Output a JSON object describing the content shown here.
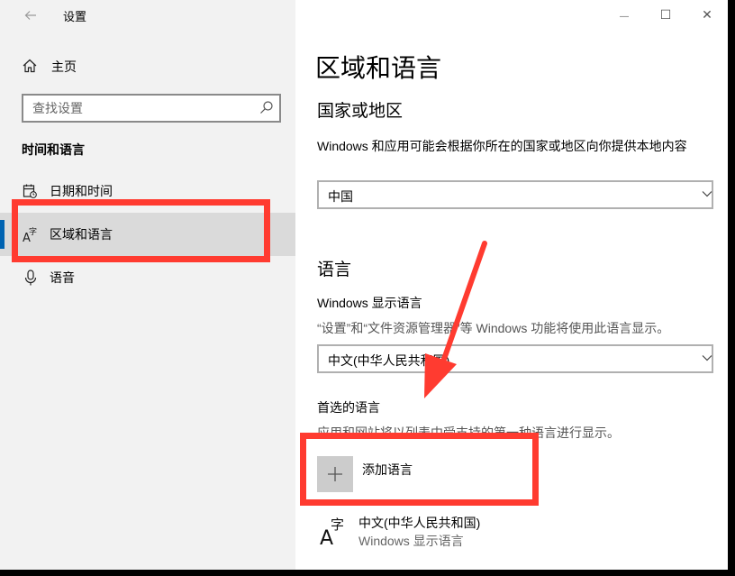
{
  "titlebar": {
    "back_icon": "back-arrow-icon",
    "app_title": "设置",
    "minimize_glyph": "—",
    "maximize_glyph": "☐",
    "close_glyph": "✕"
  },
  "sidebar": {
    "home_label": "主页",
    "search_placeholder": "查找设置",
    "section_title": "时间和语言",
    "items": [
      {
        "label": "日期和时间",
        "icon": "calendar-clock-icon"
      },
      {
        "label": "区域和语言",
        "icon": "region-language-icon",
        "active": true
      },
      {
        "label": "语音",
        "icon": "microphone-icon"
      }
    ]
  },
  "main": {
    "title": "区域和语言",
    "country": {
      "heading": "国家或地区",
      "description": "Windows 和应用可能会根据你所在的国家或地区向你提供本地内容",
      "selected": "中国"
    },
    "language": {
      "heading": "语言",
      "display_heading": "Windows 显示语言",
      "display_description": "“设置”和“文件资源管理器”等 Windows 功能将使用此语言显示。",
      "display_selected": "中文(中华人民共和国)",
      "preferred_heading": "首选的语言",
      "preferred_description": "应用和网站将以列表中受支持的第一种语言进行显示。",
      "add_label": "添加语言",
      "entries": [
        {
          "name": "中文(中华人民共和国)",
          "sub": "Windows 显示语言"
        }
      ]
    }
  },
  "colors": {
    "accent": "#0063b1",
    "annotation": "#ff3b30",
    "sidebar_bg": "#f2f2f2",
    "active_bg": "#dadada"
  }
}
